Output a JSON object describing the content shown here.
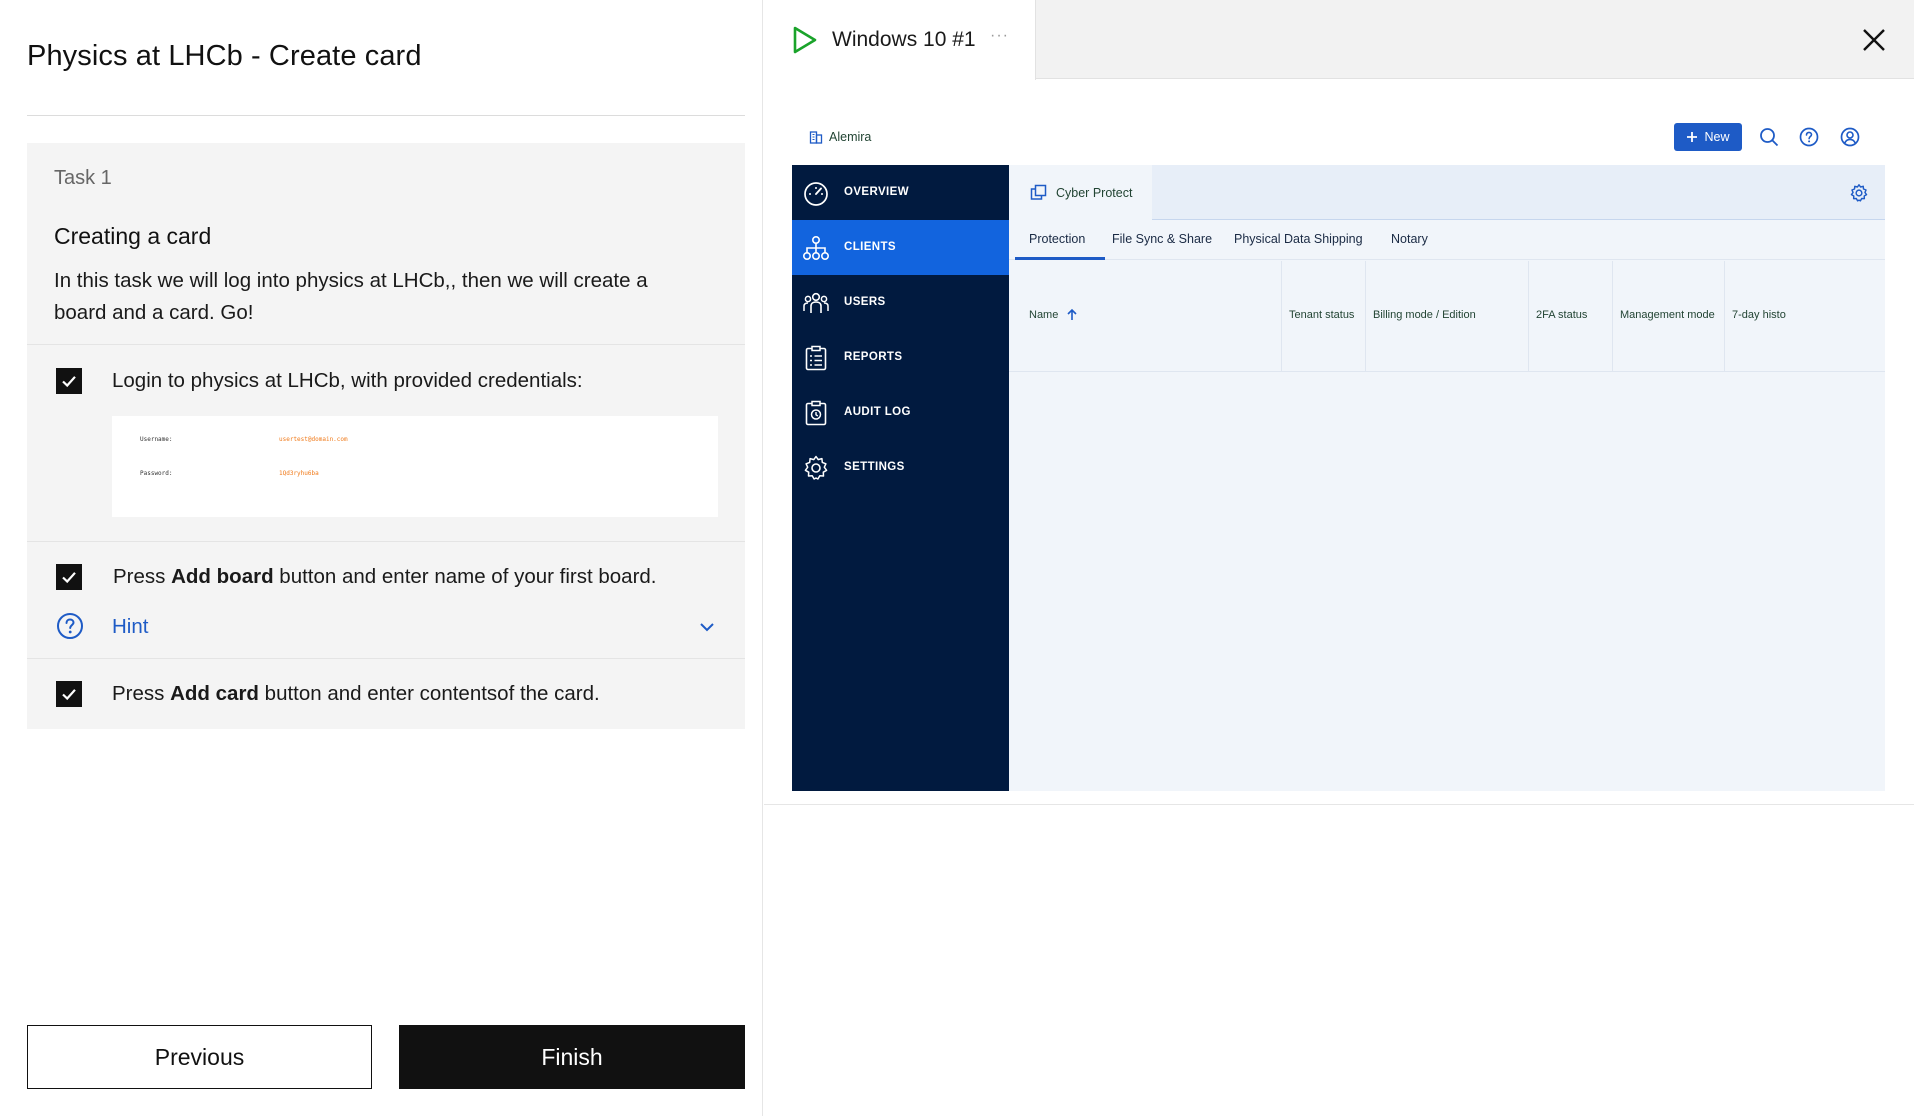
{
  "task_panel": {
    "title": "Physics at LHCb - Create card",
    "task_number": "Task 1",
    "heading": "Creating a card",
    "description": "In this task we will log into physics at LHCb,, then we will create a board and a card. Go!",
    "steps": [
      {
        "prefix": "Login to physics at LHCb, with provided credentials:",
        "bold": "",
        "suffix": "",
        "checked": true
      },
      {
        "prefix": "Press ",
        "bold": "Add board",
        "suffix": " button and enter name of your first board.",
        "checked": true
      },
      {
        "prefix": "Press ",
        "bold": "Add card",
        "suffix": " button and enter contentsof the card.",
        "checked": true
      }
    ],
    "credentials": {
      "username_label": "Username:",
      "username_value": "usertest@domain.com",
      "password_label": "Password:",
      "password_value": "1Qd3ryhu6ba"
    },
    "hint_label": "Hint",
    "previous_label": "Previous",
    "finish_label": "Finish"
  },
  "vm": {
    "tab_title": "Windows 10 #1",
    "tab_more": "···",
    "colors": {
      "play": "#1aa32a",
      "accent": "#1e5bc6",
      "sidebar": "#011a3f",
      "active": "#1264de"
    }
  },
  "app": {
    "org_name": "Alemira",
    "new_label": "New",
    "nav": [
      {
        "label": "OVERVIEW",
        "icon": "gauge-icon",
        "active": false
      },
      {
        "label": "CLIENTS",
        "icon": "org-tree-icon",
        "active": true
      },
      {
        "label": "USERS",
        "icon": "users-icon",
        "active": false
      },
      {
        "label": "REPORTS",
        "icon": "clipboard-icon",
        "active": false
      },
      {
        "label": "AUDIT LOG",
        "icon": "audit-log-icon",
        "active": false
      },
      {
        "label": "SETTINGS",
        "icon": "gear-icon",
        "active": false
      }
    ],
    "service_tab": "Cyber Protect",
    "subtabs": [
      "Protection",
      "File Sync & Share",
      "Physical Data Shipping",
      "Notary"
    ],
    "columns": [
      "Name",
      "Tenant status",
      "Billing mode / Edition",
      "2FA status",
      "Management mode",
      "7-day histo"
    ]
  }
}
